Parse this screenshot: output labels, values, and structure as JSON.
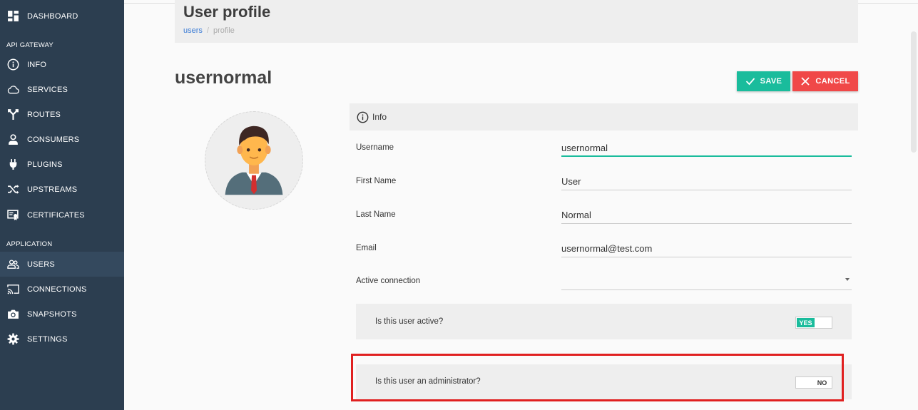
{
  "sidebar": {
    "items": [
      {
        "label": "DASHBOARD",
        "icon": "dashboard-icon"
      },
      {
        "label": "INFO",
        "icon": "info-icon"
      },
      {
        "label": "SERVICES",
        "icon": "cloud-icon"
      },
      {
        "label": "ROUTES",
        "icon": "routes-icon"
      },
      {
        "label": "CONSUMERS",
        "icon": "user-icon"
      },
      {
        "label": "PLUGINS",
        "icon": "plug-icon"
      },
      {
        "label": "UPSTREAMS",
        "icon": "shuffle-icon"
      },
      {
        "label": "CERTIFICATES",
        "icon": "certificate-icon"
      },
      {
        "label": "USERS",
        "icon": "users-icon"
      },
      {
        "label": "CONNECTIONS",
        "icon": "cast-icon"
      },
      {
        "label": "SNAPSHOTS",
        "icon": "camera-icon"
      },
      {
        "label": "SETTINGS",
        "icon": "gear-icon"
      }
    ],
    "sections": {
      "api_gateway": "API GATEWAY",
      "application": "APPLICATION"
    },
    "active": "USERS"
  },
  "header": {
    "title": "User profile",
    "breadcrumb": {
      "link": "users",
      "separator": "/",
      "current": "profile"
    }
  },
  "profile": {
    "username_title": "usernormal",
    "save_label": "SAVE",
    "cancel_label": "CANCEL"
  },
  "info": {
    "section_label": "Info",
    "fields": {
      "username": {
        "label": "Username",
        "value": "usernormal"
      },
      "first_name": {
        "label": "First Name",
        "value": "User"
      },
      "last_name": {
        "label": "Last Name",
        "value": "Normal"
      },
      "email": {
        "label": "Email",
        "value": "usernormal@test.com"
      },
      "active_connection": {
        "label": "Active connection",
        "value": ""
      }
    },
    "toggles": {
      "active": {
        "question": "Is this user active?",
        "on_label": "YES",
        "state": "on"
      },
      "admin": {
        "question": "Is this user an administrator?",
        "off_label": "NO",
        "state": "off"
      }
    }
  },
  "colors": {
    "sidebar_bg": "#2c3e50",
    "accent": "#1abc9c",
    "danger": "#f04848",
    "highlight": "#e02020",
    "link": "#3a7bd5"
  }
}
